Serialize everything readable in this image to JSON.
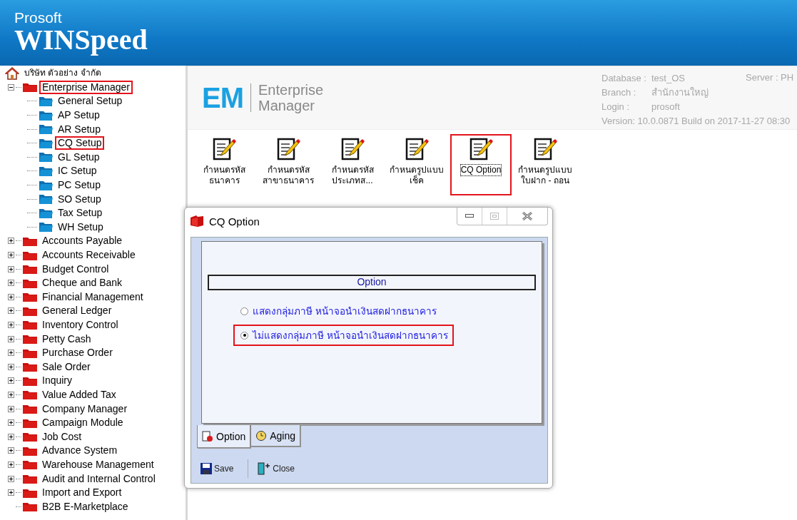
{
  "app": {
    "brand": "Prosoft",
    "product": "WINSpeed"
  },
  "tree": {
    "root": "บริษัท ตัวอย่าง จำกัด",
    "items": [
      {
        "label": "Enterprise Manager",
        "expandable": true,
        "expanded": true,
        "highlighted": true,
        "children": [
          {
            "label": "General Setup",
            "highlighted": false
          },
          {
            "label": "AP Setup",
            "highlighted": false
          },
          {
            "label": "AR Setup",
            "highlighted": false
          },
          {
            "label": "CQ Setup",
            "highlighted": true
          },
          {
            "label": "GL Setup",
            "highlighted": false
          },
          {
            "label": "IC Setup",
            "highlighted": false
          },
          {
            "label": "PC Setup",
            "highlighted": false
          },
          {
            "label": "SO Setup",
            "highlighted": false
          },
          {
            "label": "Tax Setup",
            "highlighted": false
          },
          {
            "label": "WH Setup",
            "highlighted": false
          }
        ]
      },
      {
        "label": "Accounts Payable",
        "expandable": true,
        "expanded": false,
        "highlighted": false
      },
      {
        "label": "Accounts Receivable",
        "expandable": true,
        "expanded": false,
        "highlighted": false
      },
      {
        "label": "Budget Control",
        "expandable": true,
        "expanded": false,
        "highlighted": false
      },
      {
        "label": "Cheque and Bank",
        "expandable": true,
        "expanded": false,
        "highlighted": false
      },
      {
        "label": "Financial Management",
        "expandable": true,
        "expanded": false,
        "highlighted": false
      },
      {
        "label": "General Ledger",
        "expandable": true,
        "expanded": false,
        "highlighted": false
      },
      {
        "label": "Inventory Control",
        "expandable": true,
        "expanded": false,
        "highlighted": false
      },
      {
        "label": "Petty Cash",
        "expandable": true,
        "expanded": false,
        "highlighted": false
      },
      {
        "label": "Purchase Order",
        "expandable": true,
        "expanded": false,
        "highlighted": false
      },
      {
        "label": "Sale Order",
        "expandable": true,
        "expanded": false,
        "highlighted": false
      },
      {
        "label": "Inquiry",
        "expandable": true,
        "expanded": false,
        "highlighted": false
      },
      {
        "label": "Value Added Tax",
        "expandable": true,
        "expanded": false,
        "highlighted": false
      },
      {
        "label": "Company Manager",
        "expandable": true,
        "expanded": false,
        "highlighted": false
      },
      {
        "label": "Campaign Module",
        "expandable": true,
        "expanded": false,
        "highlighted": false
      },
      {
        "label": "Job Cost",
        "expandable": true,
        "expanded": false,
        "highlighted": false
      },
      {
        "label": "Advance System",
        "expandable": true,
        "expanded": false,
        "highlighted": false
      },
      {
        "label": "Warehouse Management",
        "expandable": true,
        "expanded": false,
        "highlighted": false
      },
      {
        "label": "Audit and Internal Control",
        "expandable": true,
        "expanded": false,
        "highlighted": false
      },
      {
        "label": "Import and Export",
        "expandable": true,
        "expanded": false,
        "highlighted": false
      },
      {
        "label": "B2B E-Marketplace",
        "expandable": false,
        "highlighted": false
      }
    ]
  },
  "module": {
    "logo": "EM",
    "title_lines": [
      "Enterprise",
      "Manager"
    ]
  },
  "info": [
    {
      "label": "Database :",
      "value": "test_OS"
    },
    {
      "label": "Branch :",
      "value": "สำนักงานใหญ่"
    },
    {
      "label": "Login :",
      "value": "prosoft"
    }
  ],
  "version": "Version: 10.0.0871  Build on 2017-11-27 08:30",
  "server": "Server : PH",
  "tools": [
    {
      "lines": [
        "กำหนดรหัส",
        "ธนาคาร"
      ],
      "selected": false
    },
    {
      "lines": [
        "กำหนดรหัส",
        "สาขาธนาคาร"
      ],
      "selected": false
    },
    {
      "lines": [
        "กำหนดรหัส",
        "ประเภทส..."
      ],
      "selected": false
    },
    {
      "lines": [
        "กำหนดรูปแบบ",
        "เช็ค"
      ],
      "selected": false
    },
    {
      "lines": [
        "CQ Option"
      ],
      "selected": true
    },
    {
      "lines": [
        "กำหนดรูปแบบ",
        "ใบฝาก - ถอน"
      ],
      "selected": false
    }
  ],
  "dialog": {
    "title": "CQ Option",
    "group": "Option",
    "radios": [
      {
        "label": "แสดงกลุ่มภาษี หน้าจอนำเงินสดฝากธนาคาร",
        "selected": false,
        "highlighted": false
      },
      {
        "label": "ไม่แสดงกลุ่มภาษี หน้าจอนำเงินสดฝากธนาคาร",
        "selected": true,
        "highlighted": true
      }
    ],
    "tabs": [
      {
        "label": "Option",
        "kind": "option",
        "selected": true
      },
      {
        "label": "Aging",
        "kind": "aging",
        "selected": false
      }
    ],
    "buttons": [
      {
        "label": "Save",
        "kind": "save"
      },
      {
        "label": "Close",
        "kind": "close"
      }
    ]
  }
}
